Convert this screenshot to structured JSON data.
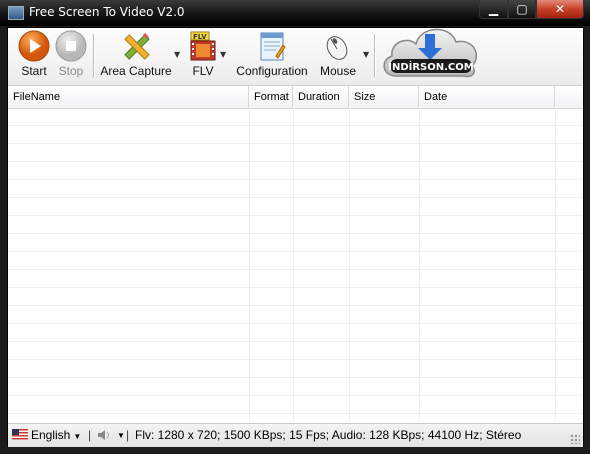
{
  "window": {
    "title": "Free Screen To Video V2.0",
    "controls": {
      "minimize": "▁",
      "maximize": "▢",
      "close": "✕"
    }
  },
  "toolbar": {
    "items": [
      {
        "label": "Start",
        "icon": "record-start-icon",
        "enabled": true
      },
      {
        "label": "Stop",
        "icon": "stop-icon",
        "enabled": false
      },
      {
        "label": "Area Capture",
        "icon": "pencil-ruler-icon",
        "has_dropdown": true
      },
      {
        "label": "FLV",
        "icon": "film-flv-icon",
        "has_dropdown": true
      },
      {
        "label": "Configuration",
        "icon": "config-document-icon"
      },
      {
        "label": "Mouse",
        "icon": "mouse-icon",
        "has_dropdown": true
      }
    ],
    "logo_text": "İNDİRSON.COM"
  },
  "table": {
    "columns": [
      "FileName",
      "Format",
      "Duration",
      "Size",
      "Date"
    ],
    "rows": []
  },
  "statusbar": {
    "language": "English",
    "info": "Flv: 1280 x 720; 1500 KBps; 15 Fps; Audio: 128 KBps; 44100 Hz; Stéreo"
  },
  "colors": {
    "start_button": "#e8741e",
    "close_button": "#c7402a",
    "titlebar": "#000000"
  }
}
